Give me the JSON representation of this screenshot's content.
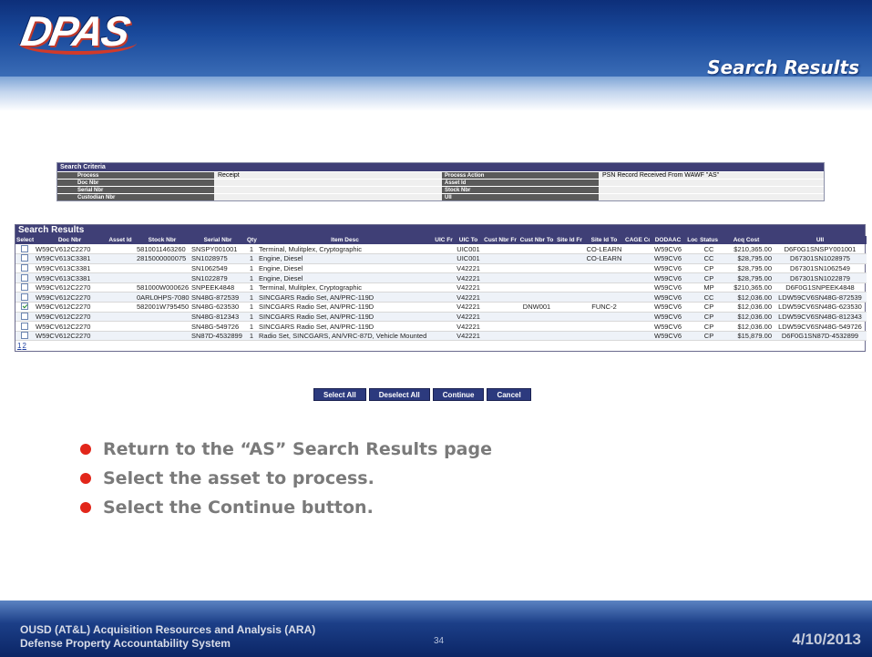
{
  "slide": {
    "logo_text": "DPAS",
    "title": "Search Results"
  },
  "criteria": {
    "heading": "Search Criteria",
    "rows": [
      {
        "label": "Process",
        "value": "Receipt",
        "label2": "Process Action",
        "value2": "PSN Record Received From WAWF \"AS\""
      },
      {
        "label": "Doc Nbr",
        "value": "",
        "label2": "Asset Id",
        "value2": ""
      },
      {
        "label": "Serial Nbr",
        "value": "",
        "label2": "Stock Nbr",
        "value2": ""
      },
      {
        "label": "Custodian Nbr",
        "value": "",
        "label2": "UII",
        "value2": ""
      }
    ]
  },
  "results": {
    "heading": "Search Results",
    "columns": [
      "Select",
      "Doc Nbr",
      "Asset Id",
      "Stock Nbr",
      "Serial Nbr",
      "Qty",
      "Item Desc",
      "UIC Fr",
      "UIC To",
      "Cust Nbr Fr",
      "Cust Nbr To",
      "Site Id Fr",
      "Site Id To",
      "CAGE Cd",
      "DODAAC",
      "Loc",
      "Status",
      "Acq Cost",
      "UII"
    ],
    "rows": [
      {
        "checked": false,
        "doc": "W59CV612C2270",
        "asset": "",
        "stock": "5810011463260",
        "serial": "SNSPY001001",
        "qty": "1",
        "desc": "Terminal, Mulitplex, Cryptographic",
        "uic_fr": "",
        "uic_to": "UIC001",
        "cust_fr": "",
        "cust_to": "",
        "site_fr": "",
        "site_to": "CO-LEARN",
        "cage": "",
        "dodaac": "W59CV6",
        "loc": "",
        "status": "CC",
        "cost": "$210,365.00",
        "uii": "D6F0G1SNSPY001001"
      },
      {
        "checked": false,
        "doc": "W59CV613C3381",
        "asset": "",
        "stock": "2815000000075",
        "serial": "SN1028975",
        "qty": "1",
        "desc": "Engine, Diesel",
        "uic_fr": "",
        "uic_to": "UIC001",
        "cust_fr": "",
        "cust_to": "",
        "site_fr": "",
        "site_to": "CO-LEARN",
        "cage": "",
        "dodaac": "W59CV6",
        "loc": "",
        "status": "CC",
        "cost": "$28,795.00",
        "uii": "D67301SN1028975"
      },
      {
        "checked": false,
        "doc": "W59CV613C3381",
        "asset": "",
        "stock": "",
        "serial": "SN1062549",
        "qty": "1",
        "desc": "Engine, Diesel",
        "uic_fr": "",
        "uic_to": "V42221",
        "cust_fr": "",
        "cust_to": "",
        "site_fr": "",
        "site_to": "",
        "cage": "",
        "dodaac": "W59CV6",
        "loc": "",
        "status": "CP",
        "cost": "$28,795.00",
        "uii": "D67301SN1062549"
      },
      {
        "checked": false,
        "doc": "W59CV613C3381",
        "asset": "",
        "stock": "",
        "serial": "SN1022879",
        "qty": "1",
        "desc": "Engine, Diesel",
        "uic_fr": "",
        "uic_to": "V42221",
        "cust_fr": "",
        "cust_to": "",
        "site_fr": "",
        "site_to": "",
        "cage": "",
        "dodaac": "W59CV6",
        "loc": "",
        "status": "CP",
        "cost": "$28,795.00",
        "uii": "D67301SN1022879"
      },
      {
        "checked": false,
        "doc": "W59CV612C2270",
        "asset": "",
        "stock": "581000W000626",
        "serial": "SNPEEK4848",
        "qty": "1",
        "desc": "Terminal, Mulitplex, Cryptographic",
        "uic_fr": "",
        "uic_to": "V42221",
        "cust_fr": "",
        "cust_to": "",
        "site_fr": "",
        "site_to": "",
        "cage": "",
        "dodaac": "W59CV6",
        "loc": "",
        "status": "MP",
        "cost": "$210,365.00",
        "uii": "D6F0G1SNPEEK4848"
      },
      {
        "checked": false,
        "doc": "W59CV612C2270",
        "asset": "",
        "stock": "0ARL0HPS-7080",
        "serial": "SN48G-872539",
        "qty": "1",
        "desc": "SINCGARS Radio Set, AN/PRC-119D",
        "uic_fr": "",
        "uic_to": "V42221",
        "cust_fr": "",
        "cust_to": "",
        "site_fr": "",
        "site_to": "",
        "cage": "",
        "dodaac": "W59CV6",
        "loc": "",
        "status": "CC",
        "cost": "$12,036.00",
        "uii": "LDW59CV6SN48G-872539"
      },
      {
        "checked": true,
        "doc": "W59CV612C2270",
        "asset": "",
        "stock": "582001W795450",
        "serial": "SN48G-623530",
        "qty": "1",
        "desc": "SINCGARS Radio Set, AN/PRC-119D",
        "uic_fr": "",
        "uic_to": "V42221",
        "cust_fr": "",
        "cust_to": "DNW001",
        "site_fr": "",
        "site_to": "FUNC-2",
        "cage": "",
        "dodaac": "W59CV6",
        "loc": "",
        "status": "CP",
        "cost": "$12,036.00",
        "uii": "LDW59CV6SN48G-623530"
      },
      {
        "checked": false,
        "doc": "W59CV612C2270",
        "asset": "",
        "stock": "",
        "serial": "SN48G-812343",
        "qty": "1",
        "desc": "SINCGARS Radio Set, AN/PRC-119D",
        "uic_fr": "",
        "uic_to": "V42221",
        "cust_fr": "",
        "cust_to": "",
        "site_fr": "",
        "site_to": "",
        "cage": "",
        "dodaac": "W59CV6",
        "loc": "",
        "status": "CP",
        "cost": "$12,036.00",
        "uii": "LDW59CV6SN48G-812343"
      },
      {
        "checked": false,
        "doc": "W59CV612C2270",
        "asset": "",
        "stock": "",
        "serial": "SN48G-549726",
        "qty": "1",
        "desc": "SINCGARS Radio Set, AN/PRC-119D",
        "uic_fr": "",
        "uic_to": "V42221",
        "cust_fr": "",
        "cust_to": "",
        "site_fr": "",
        "site_to": "",
        "cage": "",
        "dodaac": "W59CV6",
        "loc": "",
        "status": "CP",
        "cost": "$12,036.00",
        "uii": "LDW59CV6SN48G-549726"
      },
      {
        "checked": false,
        "doc": "W59CV612C2270",
        "asset": "",
        "stock": "",
        "serial": "SN87D-4532899",
        "qty": "1",
        "desc": "Radio Set, SINCGARS, AN/VRC-87D, Vehicle Mounted",
        "uic_fr": "",
        "uic_to": "V42221",
        "cust_fr": "",
        "cust_to": "",
        "site_fr": "",
        "site_to": "",
        "cage": "",
        "dodaac": "W59CV6",
        "loc": "",
        "status": "CP",
        "cost": "$15,879.00",
        "uii": "D6F0G1SN87D-4532899"
      }
    ],
    "pages": [
      "1",
      "2"
    ]
  },
  "buttons": {
    "select_all": "Select All",
    "deselect_all": "Deselect All",
    "continue": "Continue",
    "cancel": "Cancel"
  },
  "bullets": [
    "Return to the “AS” Search Results page",
    "Select the asset to process.",
    "Select the Continue button."
  ],
  "footer": {
    "line1": "OUSD (AT&L) Acquisition Resources and Analysis (ARA)",
    "line2": "Defense Property Accountability System",
    "page_number": "34",
    "date": "4/10/2013"
  },
  "colors": {
    "header_blue": "#1a4a9c",
    "table_header": "#3f3f76",
    "bullet_red": "#e2261a",
    "button_blue": "#2c3a7e"
  }
}
